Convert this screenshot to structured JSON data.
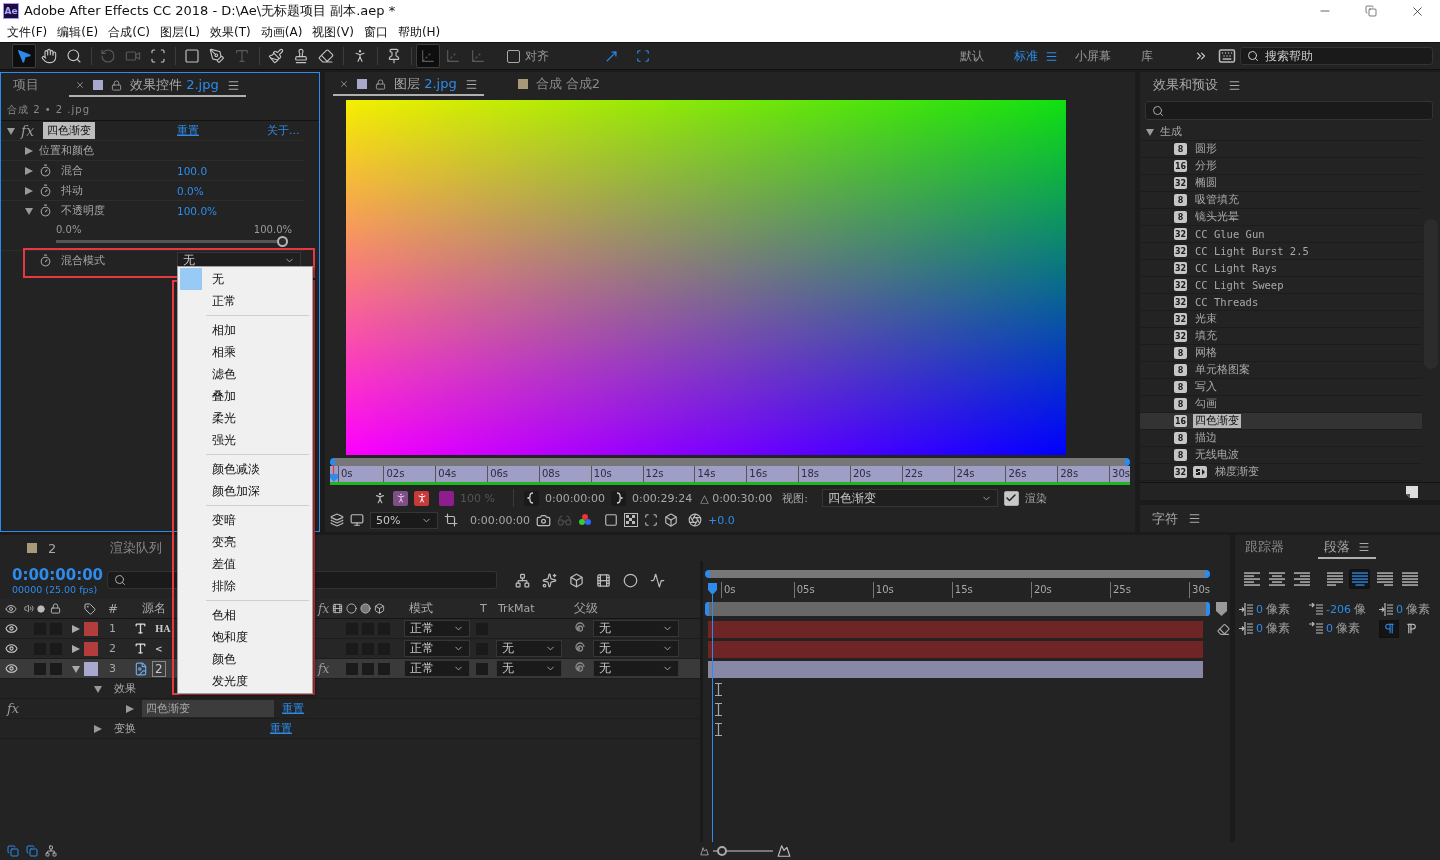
{
  "window": {
    "app_icon": "Ae",
    "title": "Adobe After Effects CC 2018 - D:\\Ae\\无标题项目 副本.aep *"
  },
  "menu_bar": [
    "文件(F)",
    "编辑(E)",
    "合成(C)",
    "图层(L)",
    "效果(T)",
    "动画(A)",
    "视图(V)",
    "窗口",
    "帮助(H)"
  ],
  "toolbar": {
    "tool_groups": [
      [
        {
          "kind": "selection",
          "selected": true,
          "disabled": false
        },
        {
          "kind": "hand",
          "selected": false,
          "disabled": false
        },
        {
          "kind": "zoom",
          "selected": false,
          "disabled": false
        }
      ],
      [
        {
          "kind": "rotate",
          "selected": false,
          "disabled": true
        },
        {
          "kind": "camera",
          "selected": false,
          "disabled": true
        },
        {
          "kind": "pan-behind",
          "selected": false,
          "disabled": false
        }
      ],
      [
        {
          "kind": "rectangle",
          "selected": false,
          "disabled": false
        },
        {
          "kind": "pen",
          "selected": false,
          "disabled": false
        },
        {
          "kind": "type",
          "selected": false,
          "disabled": true
        }
      ],
      [
        {
          "kind": "brush",
          "selected": false,
          "disabled": false
        },
        {
          "kind": "stamp",
          "selected": false,
          "disabled": false
        },
        {
          "kind": "eraser",
          "selected": false,
          "disabled": false
        }
      ],
      [
        {
          "kind": "roto",
          "selected": false,
          "disabled": false
        }
      ],
      [
        {
          "kind": "puppet",
          "selected": false,
          "disabled": false
        }
      ],
      [
        {
          "kind": "axis",
          "selected": true,
          "disabled": true
        },
        {
          "kind": "axis",
          "selected": false,
          "disabled": true
        },
        {
          "kind": "axis",
          "selected": false,
          "disabled": true
        }
      ]
    ],
    "snap": {
      "label": "对齐",
      "checked": false
    },
    "workspaces": [
      {
        "label": "默认",
        "selected": false
      },
      {
        "label": "标准",
        "selected": true
      },
      {
        "label": "小屏幕",
        "selected": false
      },
      {
        "label": "库",
        "selected": false
      }
    ],
    "search": {
      "placeholder": "搜索帮助"
    }
  },
  "effect_controls": {
    "tabs": [
      {
        "label": "项目",
        "selected": false
      },
      {
        "label": "效果控件",
        "file": "2.jpg",
        "color": "#a8a8cc",
        "selected": true
      }
    ],
    "breadcrumb": "合成 2 • 2 .jpg",
    "effect": {
      "fx": "fx",
      "name": "四色渐变",
      "expanded": true,
      "reset": "重置",
      "about": "关于..."
    },
    "properties": [
      {
        "kind": "group",
        "name": "位置和颜色",
        "expanded": false
      },
      {
        "kind": "value",
        "name": "混合",
        "value": "100.0",
        "expanded": false
      },
      {
        "kind": "value",
        "name": "抖动",
        "value": "0.0%",
        "expanded": false
      },
      {
        "kind": "slider",
        "name": "不透明度",
        "value": "100.0%",
        "expanded": true,
        "min": "0.0%",
        "max": "100.0%",
        "level": 1
      },
      {
        "kind": "dropdown",
        "name": "混合模式",
        "value": "无"
      }
    ]
  },
  "blend_menu": {
    "groups": [
      [
        {
          "label": "无",
          "selected": true
        },
        {
          "label": "正常",
          "selected": false
        }
      ],
      [
        {
          "label": "相加",
          "selected": false
        },
        {
          "label": "相乘",
          "selected": false
        },
        {
          "label": "滤色",
          "selected": false
        },
        {
          "label": "叠加",
          "selected": false
        },
        {
          "label": "柔光",
          "selected": false
        },
        {
          "label": "强光",
          "selected": false
        }
      ],
      [
        {
          "label": "颜色减淡",
          "selected": false
        },
        {
          "label": "颜色加深",
          "selected": false
        }
      ],
      [
        {
          "label": "变暗",
          "selected": false
        },
        {
          "label": "变亮",
          "selected": false
        },
        {
          "label": "差值",
          "selected": false
        },
        {
          "label": "排除",
          "selected": false
        }
      ],
      [
        {
          "label": "色相",
          "selected": false
        },
        {
          "label": "饱和度",
          "selected": false
        },
        {
          "label": "颜色",
          "selected": false
        },
        {
          "label": "发光度",
          "selected": false
        }
      ]
    ]
  },
  "viewer": {
    "tabs": [
      {
        "label": "图层",
        "file": "2.jpg",
        "color": "#a8a8cc",
        "selected": true
      },
      {
        "label": "合成 合成2",
        "color": "#a89a78",
        "selected": false
      }
    ],
    "ruler": [
      "0s",
      "02s",
      "04s",
      "06s",
      "08s",
      "10s",
      "12s",
      "14s",
      "16s",
      "18s",
      "20s",
      "22s",
      "24s",
      "26s",
      "28s",
      "30s"
    ],
    "opacity": "100 %",
    "in_time": "0:00:00:00",
    "out_time": "0:00:29:24",
    "duration": "△ 0:00:30:00",
    "view_label": "视图:",
    "view": "四色渐变",
    "render": {
      "label": "渲染",
      "checked": true
    },
    "zoom": "50%",
    "current_time": "0:00:00:00",
    "exposure": "+0.0"
  },
  "effects_presets": {
    "title": "效果和预设",
    "tree": [
      {
        "name": "生成",
        "expanded": true,
        "children": [
          {
            "name": "圆形",
            "bits": "8",
            "selected": false,
            "preset": false
          },
          {
            "name": "分形",
            "bits": "16",
            "selected": false,
            "preset": false
          },
          {
            "name": "椭圆",
            "bits": "32",
            "selected": false,
            "preset": false
          },
          {
            "name": "吸管填充",
            "bits": "8",
            "selected": false,
            "preset": false
          },
          {
            "name": "镜头光晕",
            "bits": "8",
            "selected": false,
            "preset": false
          },
          {
            "name": "CC Glue Gun",
            "bits": "32",
            "selected": false,
            "preset": false
          },
          {
            "name": "CC Light Burst 2.5",
            "bits": "32",
            "selected": false,
            "preset": false
          },
          {
            "name": "CC Light Rays",
            "bits": "32",
            "selected": false,
            "preset": false
          },
          {
            "name": "CC Light Sweep",
            "bits": "32",
            "selected": false,
            "preset": false
          },
          {
            "name": "CC Threads",
            "bits": "32",
            "selected": false,
            "preset": false
          },
          {
            "name": "光束",
            "bits": "32",
            "selected": false,
            "preset": false
          },
          {
            "name": "填充",
            "bits": "32",
            "selected": false,
            "preset": false
          },
          {
            "name": "网格",
            "bits": "8",
            "selected": false,
            "preset": false
          },
          {
            "name": "单元格图案",
            "bits": "8",
            "selected": false,
            "preset": false
          },
          {
            "name": "写入",
            "bits": "8",
            "selected": false,
            "preset": false
          },
          {
            "name": "勾画",
            "bits": "8",
            "selected": false,
            "preset": false
          },
          {
            "name": "四色渐变",
            "bits": "16",
            "selected": true,
            "preset": false
          },
          {
            "name": "描边",
            "bits": "8",
            "selected": false,
            "preset": false
          },
          {
            "name": "无线电波",
            "bits": "8",
            "selected": false,
            "preset": false
          },
          {
            "name": "梯度渐变",
            "bits": "32",
            "selected": false,
            "preset": true
          }
        ]
      }
    ]
  },
  "character_panel": {
    "title": "字符"
  },
  "timeline": {
    "comp_tab": {
      "label": "2",
      "color": "#a89a78"
    },
    "render_queue_tab": "渲染队列",
    "timecode": "0:00:00:00",
    "frame_info": "00000 (25.00 fps)",
    "columns": {
      "number": "#",
      "source_name": "源名",
      "fx": "fx",
      "mode": "模式",
      "t": "T",
      "trkmat": "TrkMat",
      "parent": "父级"
    },
    "layers": [
      {
        "number": "1",
        "kind": "text",
        "name": "HA",
        "color": "#b33c3c",
        "visible": true,
        "expanded": false,
        "selected": false,
        "mode": "正常",
        "parent": "无"
      },
      {
        "number": "2",
        "kind": "text",
        "name": "<",
        "color": "#b33c3c",
        "visible": true,
        "expanded": false,
        "selected": false,
        "mode": "正常",
        "trkmat": "无",
        "parent": "无"
      },
      {
        "number": "3",
        "kind": "footage",
        "name": "2",
        "color": "#a9a9d0",
        "visible": true,
        "expanded": true,
        "selected": true,
        "fx": "fx",
        "mode": "正常",
        "trkmat": "无",
        "parent": "无",
        "children": [
          {
            "name": "效果",
            "expanded": true,
            "children": [
              {
                "fx": "fx",
                "name": "四色渐变",
                "expanded": false,
                "selected": true,
                "reset": "重置"
              }
            ]
          },
          {
            "name": "变换",
            "expanded": false,
            "reset": "重置"
          }
        ]
      }
    ],
    "ruler": [
      "0s",
      "05s",
      "10s",
      "15s",
      "20s",
      "25s",
      "30s"
    ],
    "zoom_slider": {
      "level": 0.15
    }
  },
  "paragraph_panel": {
    "tabs": [
      {
        "label": "跟踪器",
        "selected": false
      },
      {
        "label": "段落",
        "selected": true
      }
    ],
    "align": [
      {
        "kind": "left",
        "selected": false
      },
      {
        "kind": "center",
        "selected": false
      },
      {
        "kind": "right",
        "selected": false
      },
      {
        "kind": "justify-left",
        "selected": false
      },
      {
        "kind": "justify-center",
        "selected": true
      },
      {
        "kind": "justify-right",
        "selected": false
      },
      {
        "kind": "justify-all",
        "selected": false
      }
    ],
    "spacing": [
      {
        "kind": "indent-left",
        "value": "0",
        "unit": "像素"
      },
      {
        "kind": "space-before",
        "value": "-206",
        "unit": "像"
      },
      {
        "kind": "indent-first",
        "value": "0",
        "unit": "像素"
      },
      {
        "kind": "indent-right",
        "value": "0",
        "unit": "像素"
      },
      {
        "kind": "space-after",
        "value": "0",
        "unit": "像素"
      }
    ],
    "direction": [
      {
        "kind": "ltr",
        "selected": true
      },
      {
        "kind": "rtl",
        "selected": false
      }
    ]
  }
}
